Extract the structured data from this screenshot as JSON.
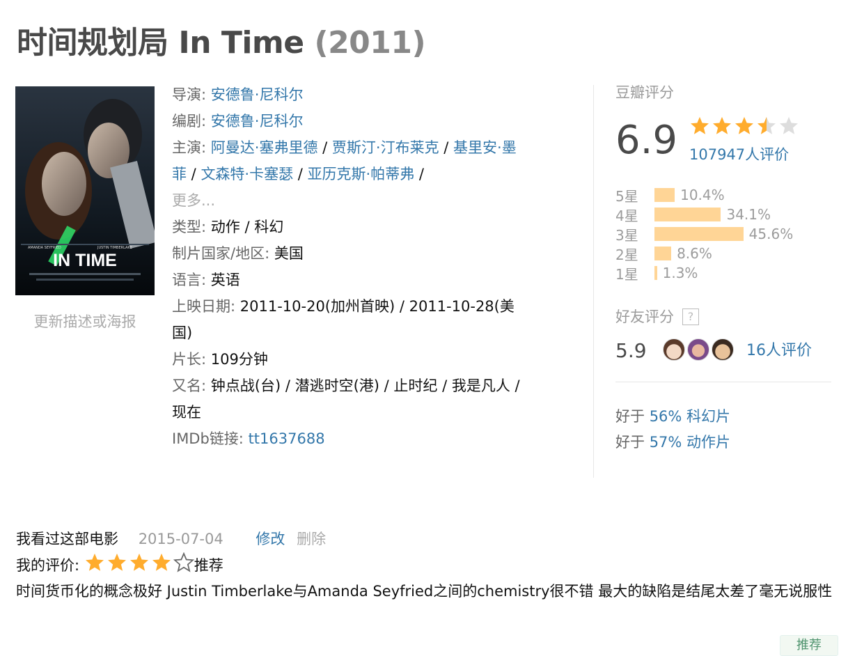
{
  "title": {
    "name": "时间规划局 In Time",
    "year": "(2011)"
  },
  "poster": {
    "actor1": "AMANDA SEYFRIED",
    "actor2": "JUSTIN TIMBERLAKE",
    "movie": "IN TIME"
  },
  "update_link": "更新描述或海报",
  "info": {
    "director_label": "导演: ",
    "director": "安德鲁·尼科尔",
    "writer_label": "编剧: ",
    "writer": "安德鲁·尼科尔",
    "cast_label": "主演: ",
    "cast": [
      "阿曼达·塞弗里德",
      "贾斯汀·汀布莱克",
      "基里安·墨菲",
      "文森特·卡塞瑟",
      "亚历克斯·帕蒂弗"
    ],
    "cast_sep": " / ",
    "more": "更多...",
    "genre_label": "类型: ",
    "genre": "动作 / 科幻",
    "country_label": "制片国家/地区: ",
    "country": "美国",
    "language_label": "语言: ",
    "language": "英语",
    "release_label": "上映日期: ",
    "release": "2011-10-20(加州首映) / 2011-10-28(美国)",
    "runtime_label": "片长: ",
    "runtime": "109分钟",
    "aka_label": "又名: ",
    "aka": "钟点战(台) / 潜逃时空(港) / 止时纪 / 我是凡人 / 现在",
    "imdb_label": "IMDb链接: ",
    "imdb": "tt1637688"
  },
  "rating": {
    "header": "豆瓣评分",
    "score": "6.9",
    "stars": 3.5,
    "votes": "107947人评价",
    "distribution": [
      {
        "label": "5星",
        "percent": 10.4,
        "text": "10.4%"
      },
      {
        "label": "4星",
        "percent": 34.1,
        "text": "34.1%"
      },
      {
        "label": "3星",
        "percent": 45.6,
        "text": "45.6%"
      },
      {
        "label": "2星",
        "percent": 8.6,
        "text": "8.6%"
      },
      {
        "label": "1星",
        "percent": 1.3,
        "text": "1.3%"
      }
    ],
    "friend_header": "好友评分",
    "friend_help": "?",
    "friend_score": "5.9",
    "friend_count": "16人评价",
    "better_than": [
      {
        "prefix": "好于 ",
        "link": "56% 科幻片"
      },
      {
        "prefix": "好于 ",
        "link": "57% 动作片"
      }
    ]
  },
  "interest": {
    "status": "我看过这部电影",
    "date": "2015-07-04",
    "edit": "修改",
    "delete": "删除",
    "my_rating_label": "我的评价: ",
    "my_stars": 4,
    "my_rating_word": "推荐",
    "comment": "时间货币化的概念极好 Justin Timberlake与Amanda Seyfried之间的chemistry很不错 最大的缺陷是结尾太差了毫无说服性"
  },
  "recommend_button": "推荐",
  "colors": {
    "link": "#3377aa",
    "star_on": "#ffac2d",
    "star_off": "#dddddd",
    "bar": "#ffd596"
  }
}
